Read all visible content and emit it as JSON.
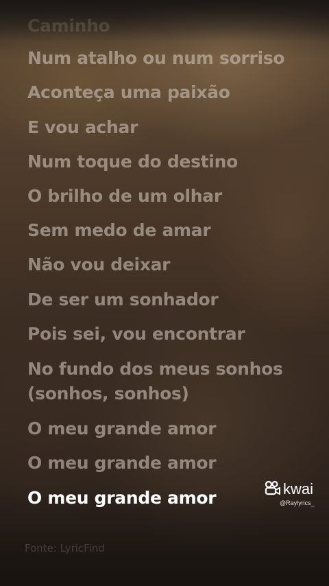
{
  "lyrics": {
    "lines": [
      "Num atalho ou num sorriso",
      "Aconteça uma paixão",
      "E vou achar",
      "Num toque do destino",
      "O brilho de um olhar",
      "Sem medo de amar",
      "Não vou deixar",
      "De ser um sonhador",
      "Pois sei, vou encontrar",
      "No fundo dos meus sonhos (sonhos, sonhos)",
      "O meu grande amor",
      "O meu grande amor",
      "O meu grande amor"
    ],
    "partial_top": "Caminho",
    "source": "Fonte: LyricFind"
  },
  "watermark": {
    "brand": "kwai",
    "handle": "@Raylyrics_",
    "icon": "kwai-camera-icon"
  },
  "colors": {
    "active_line": "#ffffff",
    "inactive_line": "#c8beb4"
  }
}
